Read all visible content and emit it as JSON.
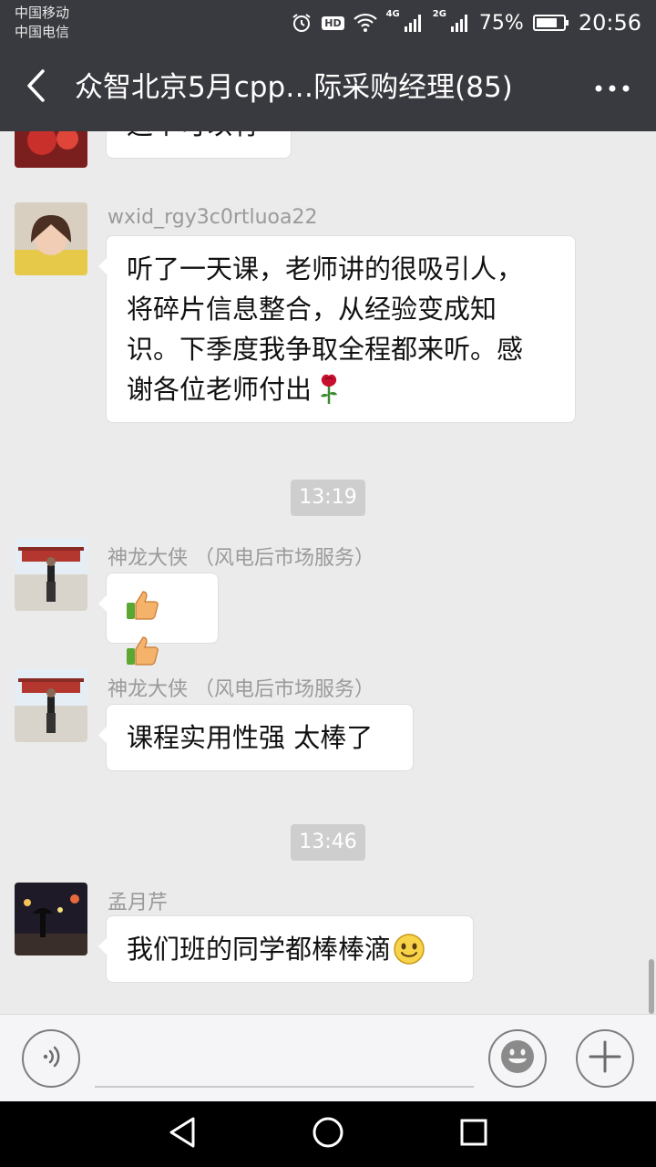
{
  "status_bar": {
    "carrier_1": "中国移动",
    "carrier_2": "中国电信",
    "hd": "HD",
    "net_1": "4G",
    "net_2": "2G",
    "battery": "75%",
    "time": "20:56"
  },
  "header": {
    "title": "众智北京5月cpp…际采购经理(85)"
  },
  "messages": [
    {
      "sender": "",
      "text": "这个可以有"
    },
    {
      "sender": "wxid_rgy3c0rtluoa22",
      "text_lines": [
        "听了一天课，老师讲的很吸引人，",
        "将碎片信息整合，从经验变成知",
        "识。下季度我争取全程都来听。感",
        "谢各位老师付出"
      ]
    },
    {
      "time": "13:19"
    },
    {
      "sender": "神龙大侠 （风电后市场服务）",
      "text": "",
      "emoji": [
        "thumbs-up",
        "thumbs-up"
      ]
    },
    {
      "sender": "神龙大侠 （风电后市场服务）",
      "text": "课程实用性强 太棒了"
    },
    {
      "time": "13:46"
    },
    {
      "sender": "孟月芹",
      "text": "我们班的同学都棒棒滴"
    }
  ],
  "icons": {
    "back": "chevron-left-icon",
    "more": "more-icon",
    "voice": "voice-icon",
    "emoji": "emoji-icon",
    "plus": "plus-icon",
    "rose": "rose-icon",
    "smile": "smile-icon"
  },
  "colors": {
    "header_bg": "#393a3f",
    "chat_bg": "#ebebeb",
    "bubble_bg": "#ffffff",
    "time_sep_bg": "#cecece"
  }
}
